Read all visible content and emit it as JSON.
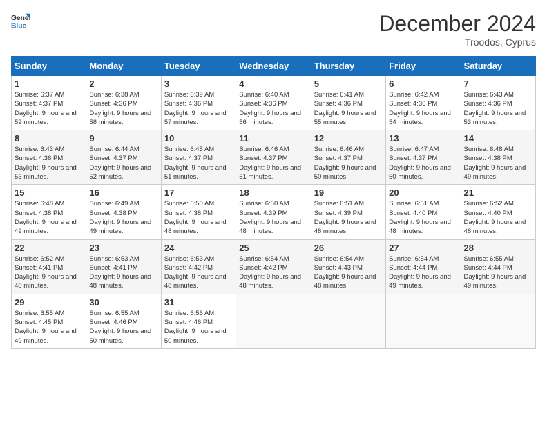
{
  "header": {
    "logo_line1": "General",
    "logo_line2": "Blue",
    "month": "December 2024",
    "location": "Troodos, Cyprus"
  },
  "weekdays": [
    "Sunday",
    "Monday",
    "Tuesday",
    "Wednesday",
    "Thursday",
    "Friday",
    "Saturday"
  ],
  "weeks": [
    [
      {
        "day": "1",
        "info": "Sunrise: 6:37 AM\nSunset: 4:37 PM\nDaylight: 9 hours\nand 59 minutes."
      },
      {
        "day": "2",
        "info": "Sunrise: 6:38 AM\nSunset: 4:36 PM\nDaylight: 9 hours\nand 58 minutes."
      },
      {
        "day": "3",
        "info": "Sunrise: 6:39 AM\nSunset: 4:36 PM\nDaylight: 9 hours\nand 57 minutes."
      },
      {
        "day": "4",
        "info": "Sunrise: 6:40 AM\nSunset: 4:36 PM\nDaylight: 9 hours\nand 56 minutes."
      },
      {
        "day": "5",
        "info": "Sunrise: 6:41 AM\nSunset: 4:36 PM\nDaylight: 9 hours\nand 55 minutes."
      },
      {
        "day": "6",
        "info": "Sunrise: 6:42 AM\nSunset: 4:36 PM\nDaylight: 9 hours\nand 54 minutes."
      },
      {
        "day": "7",
        "info": "Sunrise: 6:43 AM\nSunset: 4:36 PM\nDaylight: 9 hours\nand 53 minutes."
      }
    ],
    [
      {
        "day": "8",
        "info": "Sunrise: 6:43 AM\nSunset: 4:36 PM\nDaylight: 9 hours\nand 53 minutes."
      },
      {
        "day": "9",
        "info": "Sunrise: 6:44 AM\nSunset: 4:37 PM\nDaylight: 9 hours\nand 52 minutes."
      },
      {
        "day": "10",
        "info": "Sunrise: 6:45 AM\nSunset: 4:37 PM\nDaylight: 9 hours\nand 51 minutes."
      },
      {
        "day": "11",
        "info": "Sunrise: 6:46 AM\nSunset: 4:37 PM\nDaylight: 9 hours\nand 51 minutes."
      },
      {
        "day": "12",
        "info": "Sunrise: 6:46 AM\nSunset: 4:37 PM\nDaylight: 9 hours\nand 50 minutes."
      },
      {
        "day": "13",
        "info": "Sunrise: 6:47 AM\nSunset: 4:37 PM\nDaylight: 9 hours\nand 50 minutes."
      },
      {
        "day": "14",
        "info": "Sunrise: 6:48 AM\nSunset: 4:38 PM\nDaylight: 9 hours\nand 49 minutes."
      }
    ],
    [
      {
        "day": "15",
        "info": "Sunrise: 6:48 AM\nSunset: 4:38 PM\nDaylight: 9 hours\nand 49 minutes."
      },
      {
        "day": "16",
        "info": "Sunrise: 6:49 AM\nSunset: 4:38 PM\nDaylight: 9 hours\nand 49 minutes."
      },
      {
        "day": "17",
        "info": "Sunrise: 6:50 AM\nSunset: 4:38 PM\nDaylight: 9 hours\nand 48 minutes."
      },
      {
        "day": "18",
        "info": "Sunrise: 6:50 AM\nSunset: 4:39 PM\nDaylight: 9 hours\nand 48 minutes."
      },
      {
        "day": "19",
        "info": "Sunrise: 6:51 AM\nSunset: 4:39 PM\nDaylight: 9 hours\nand 48 minutes."
      },
      {
        "day": "20",
        "info": "Sunrise: 6:51 AM\nSunset: 4:40 PM\nDaylight: 9 hours\nand 48 minutes."
      },
      {
        "day": "21",
        "info": "Sunrise: 6:52 AM\nSunset: 4:40 PM\nDaylight: 9 hours\nand 48 minutes."
      }
    ],
    [
      {
        "day": "22",
        "info": "Sunrise: 6:52 AM\nSunset: 4:41 PM\nDaylight: 9 hours\nand 48 minutes."
      },
      {
        "day": "23",
        "info": "Sunrise: 6:53 AM\nSunset: 4:41 PM\nDaylight: 9 hours\nand 48 minutes."
      },
      {
        "day": "24",
        "info": "Sunrise: 6:53 AM\nSunset: 4:42 PM\nDaylight: 9 hours\nand 48 minutes."
      },
      {
        "day": "25",
        "info": "Sunrise: 6:54 AM\nSunset: 4:42 PM\nDaylight: 9 hours\nand 48 minutes."
      },
      {
        "day": "26",
        "info": "Sunrise: 6:54 AM\nSunset: 4:43 PM\nDaylight: 9 hours\nand 48 minutes."
      },
      {
        "day": "27",
        "info": "Sunrise: 6:54 AM\nSunset: 4:44 PM\nDaylight: 9 hours\nand 49 minutes."
      },
      {
        "day": "28",
        "info": "Sunrise: 6:55 AM\nSunset: 4:44 PM\nDaylight: 9 hours\nand 49 minutes."
      }
    ],
    [
      {
        "day": "29",
        "info": "Sunrise: 6:55 AM\nSunset: 4:45 PM\nDaylight: 9 hours\nand 49 minutes."
      },
      {
        "day": "30",
        "info": "Sunrise: 6:55 AM\nSunset: 4:46 PM\nDaylight: 9 hours\nand 50 minutes."
      },
      {
        "day": "31",
        "info": "Sunrise: 6:56 AM\nSunset: 4:46 PM\nDaylight: 9 hours\nand 50 minutes."
      },
      {
        "day": "",
        "info": ""
      },
      {
        "day": "",
        "info": ""
      },
      {
        "day": "",
        "info": ""
      },
      {
        "day": "",
        "info": ""
      }
    ]
  ]
}
